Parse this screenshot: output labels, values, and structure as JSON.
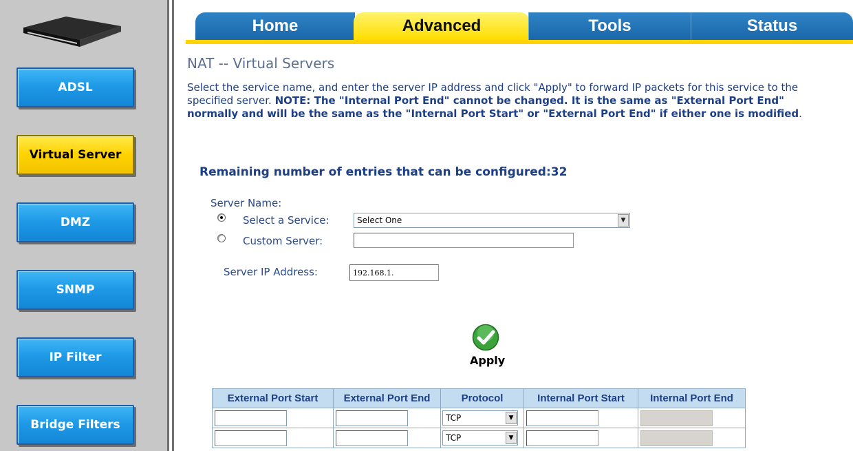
{
  "sidebar": {
    "items": [
      {
        "label": "ADSL"
      },
      {
        "label": "Virtual Server"
      },
      {
        "label": "DMZ"
      },
      {
        "label": "SNMP"
      },
      {
        "label": "IP Filter"
      },
      {
        "label": "Bridge Filters"
      }
    ],
    "active_index": 1
  },
  "tabs": [
    {
      "label": "Home"
    },
    {
      "label": "Advanced"
    },
    {
      "label": "Tools"
    },
    {
      "label": "Status"
    }
  ],
  "page": {
    "title": "NAT -- Virtual Servers",
    "desc_plain": "Select the service name, and enter the server IP address and click \"Apply\" to forward IP packets for this service to the specified server.",
    "desc_bold": "NOTE: The \"Internal Port End\" cannot be changed. It is the same as \"External Port End\" normally and will be the same as the \"Internal Port Start\" or \"External Port End\" if either one is modified",
    "desc_end": ".",
    "remaining": "Remaining number of entries that can be configured:32"
  },
  "form": {
    "server_name_label": "Server Name:",
    "select_service_label": "Select a Service:",
    "select_service_value": "Select One",
    "custom_server_label": "Custom Server:",
    "custom_server_value": "",
    "ip_label": "Server IP Address:",
    "ip_value": "192.168.1.",
    "apply_label": "Apply"
  },
  "table": {
    "headers": [
      "External Port Start",
      "External Port End",
      "Protocol",
      "Internal Port Start",
      "Internal Port End"
    ],
    "rows": [
      {
        "protocol": "TCP"
      },
      {
        "protocol": "TCP"
      }
    ]
  },
  "colors": {
    "tab_blue": "#1a67aa",
    "active_yellow": "#ffd200",
    "text_blue": "#1d3f86"
  }
}
